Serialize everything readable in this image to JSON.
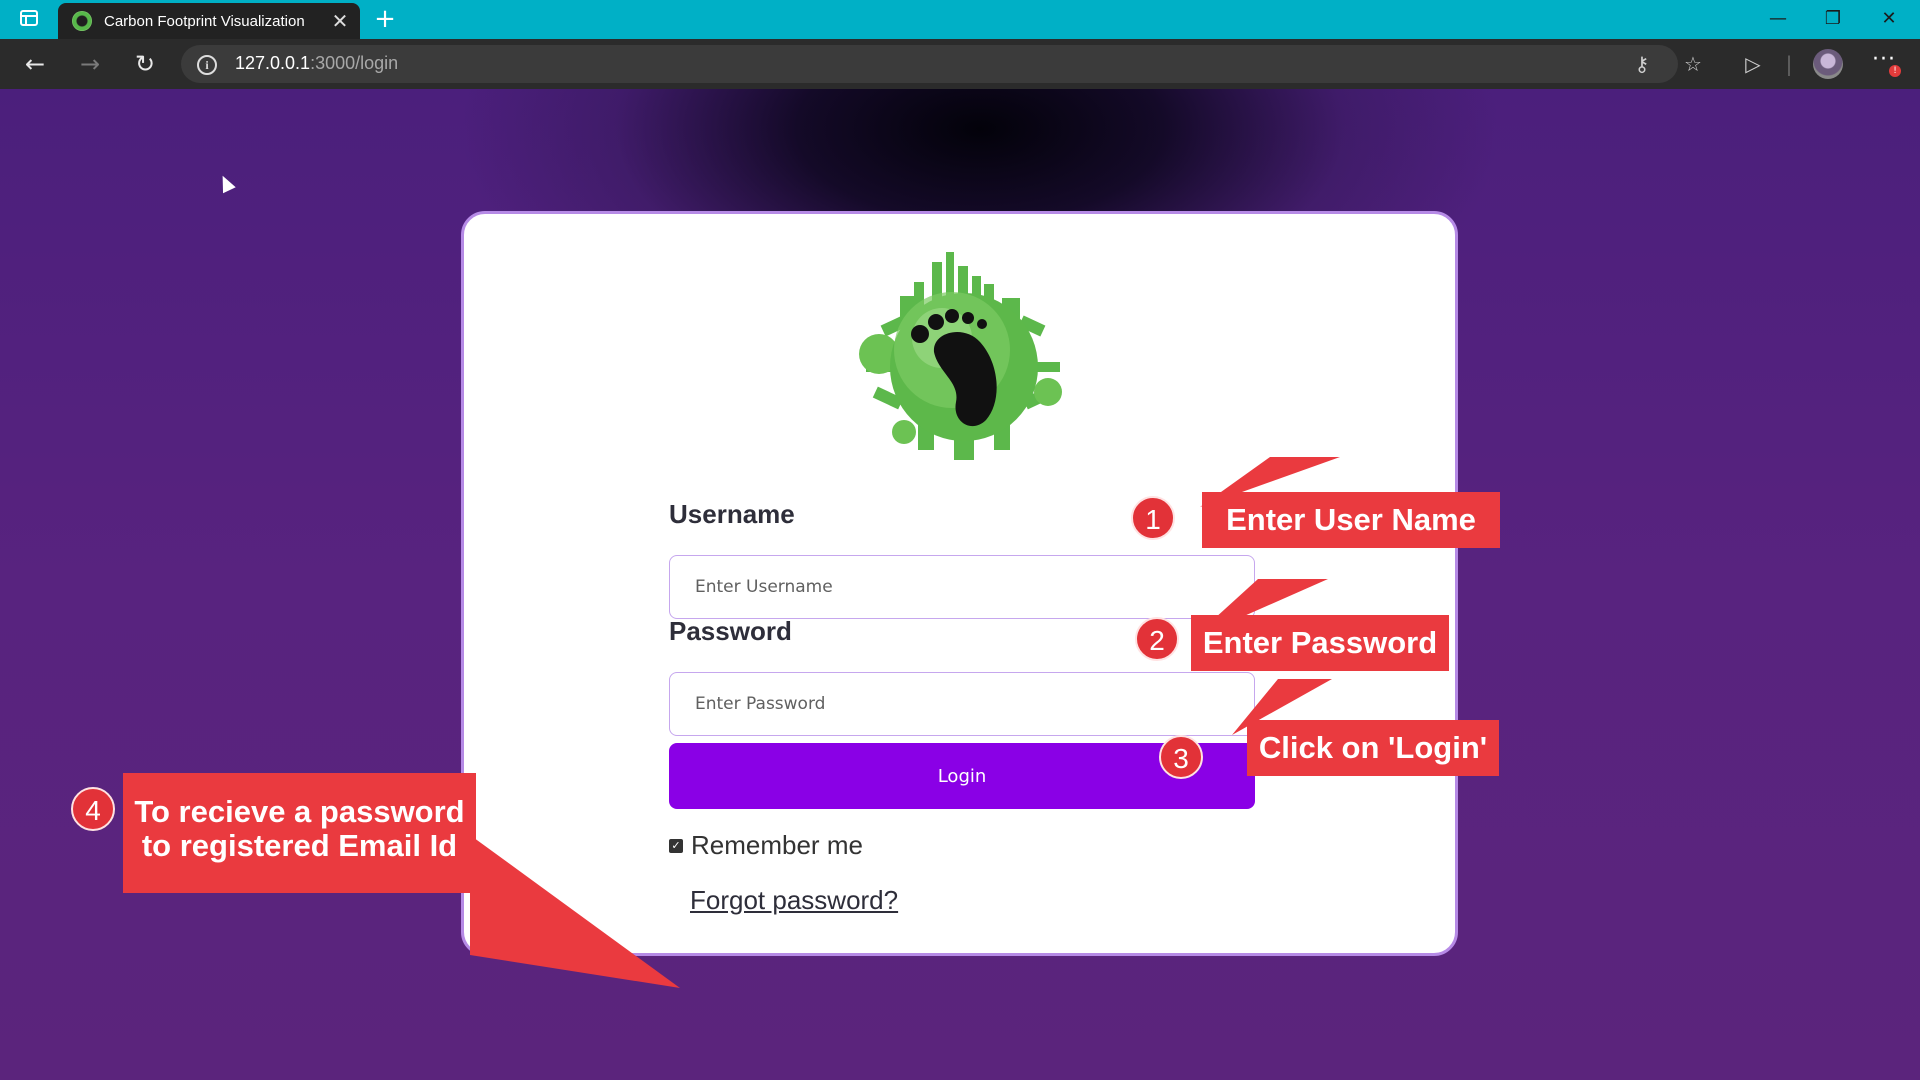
{
  "browser": {
    "tab_title": "Carbon Footprint Visualization",
    "close_glyph": "✕",
    "new_tab_glyph": "+",
    "url_host": "127.0.0.1",
    "url_path": ":3000/login",
    "window_minimize": "—",
    "window_restore": "❐",
    "window_close": "✕"
  },
  "login": {
    "username_label": "Username",
    "username_placeholder": "Enter Username",
    "password_label": "Password",
    "password_placeholder": "Enter Password",
    "login_button": "Login",
    "remember_label": "Remember me",
    "forgot_link": "Forgot password?"
  },
  "annotations": [
    {
      "number": "1",
      "text": "Enter User Name"
    },
    {
      "number": "2",
      "text": "Enter Password"
    },
    {
      "number": "3",
      "text": "Click on 'Login'"
    },
    {
      "number": "4",
      "line1": "To recieve a password",
      "line2": "to registered Email Id"
    }
  ],
  "colors": {
    "titlebar": "#00b0c6",
    "accent_purple": "#8a00e6",
    "callout_red": "#ea3a3f"
  }
}
